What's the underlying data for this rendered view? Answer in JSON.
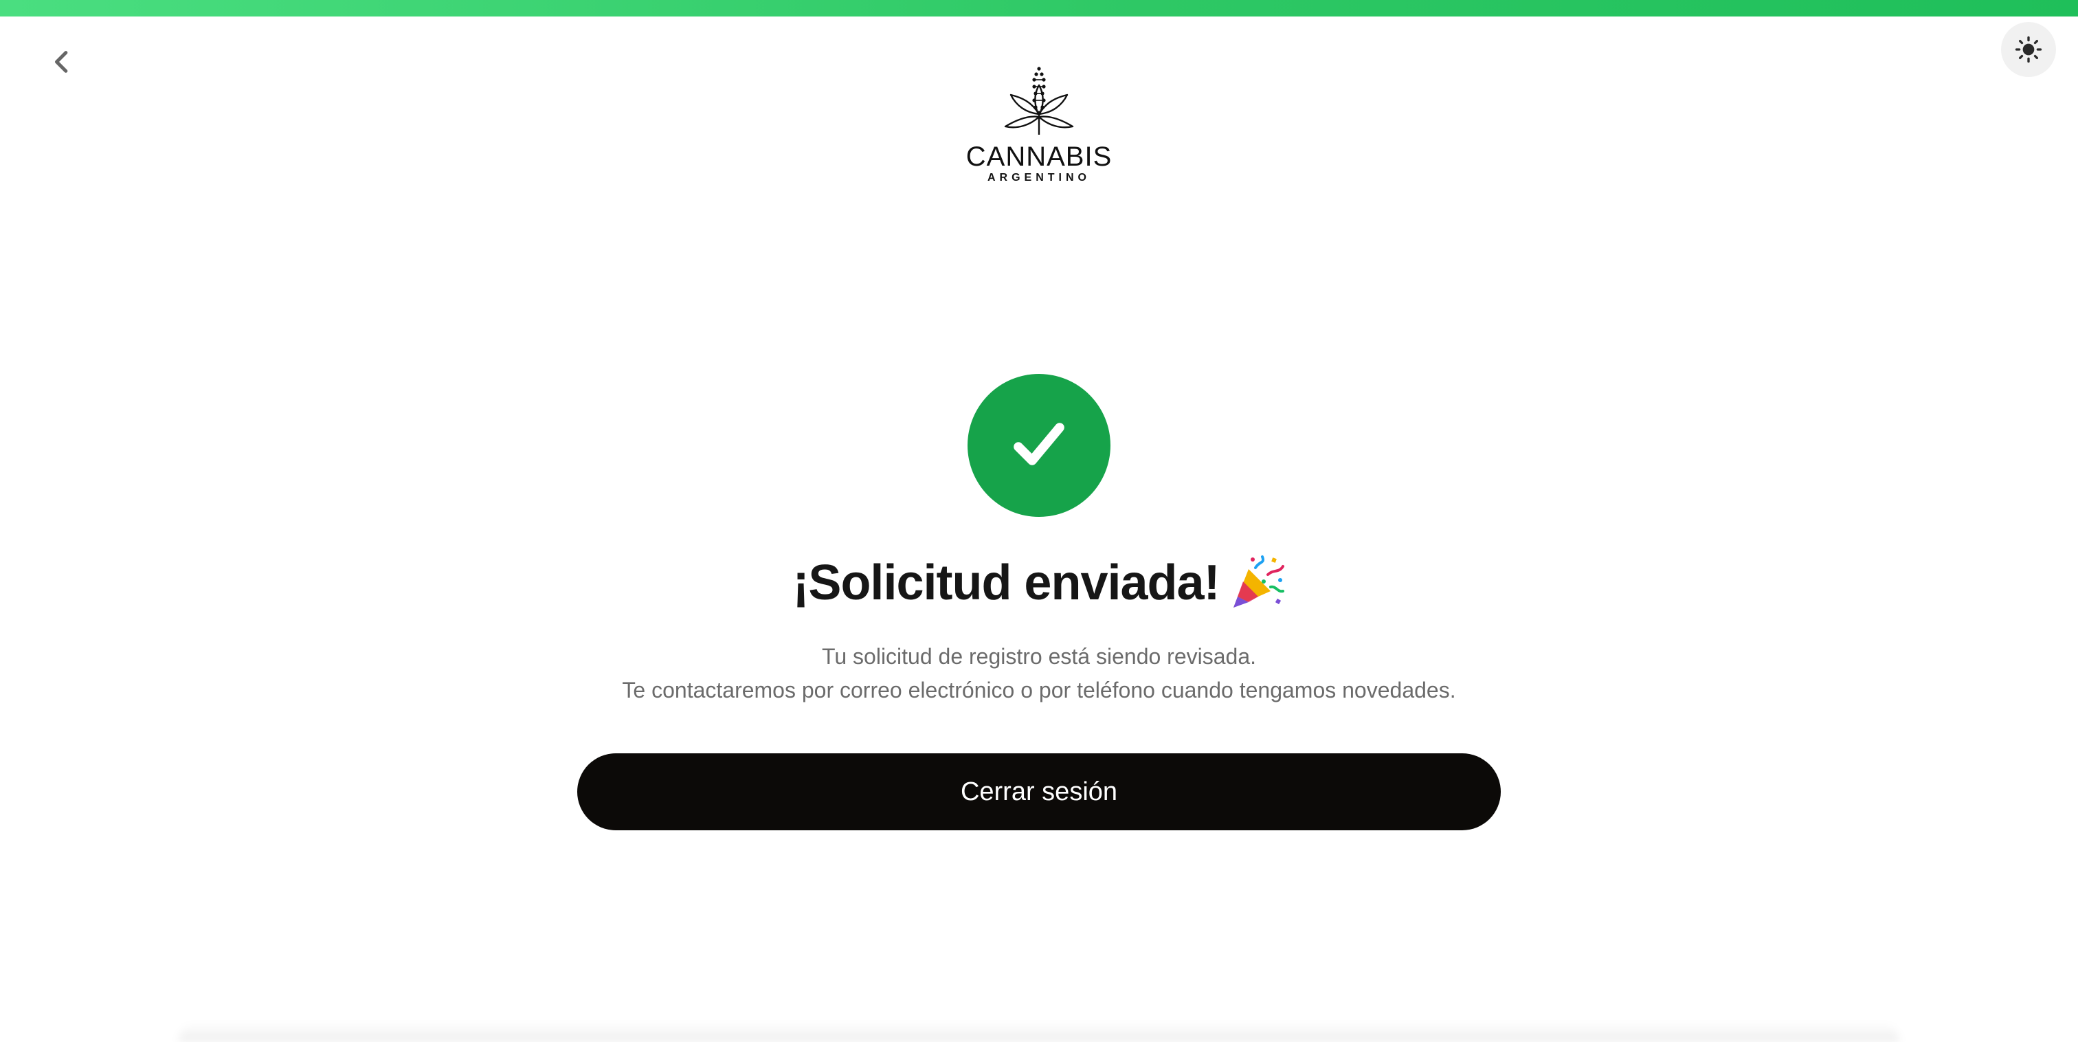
{
  "header": {
    "back_icon": "chevron-left-icon",
    "theme_icon": "sun-icon",
    "logo": {
      "name": "CANNABIS",
      "subtitle": "ARGENTINO"
    }
  },
  "main": {
    "status_icon": "check-icon",
    "title": "¡Solicitud enviada!",
    "title_icon": "party-popper-icon",
    "description_line1": "Tu solicitud de registro está siendo revisada.",
    "description_line2": "Te contactaremos por correo electrónico o por teléfono cuando tengamos novedades.",
    "logout_label": "Cerrar sesión"
  },
  "colors": {
    "accent_green": "#16a34a",
    "top_bar_green": "#2ec865",
    "button_black": "#0c0a08",
    "text_dark": "#161616",
    "text_muted": "#6b6b6b"
  }
}
